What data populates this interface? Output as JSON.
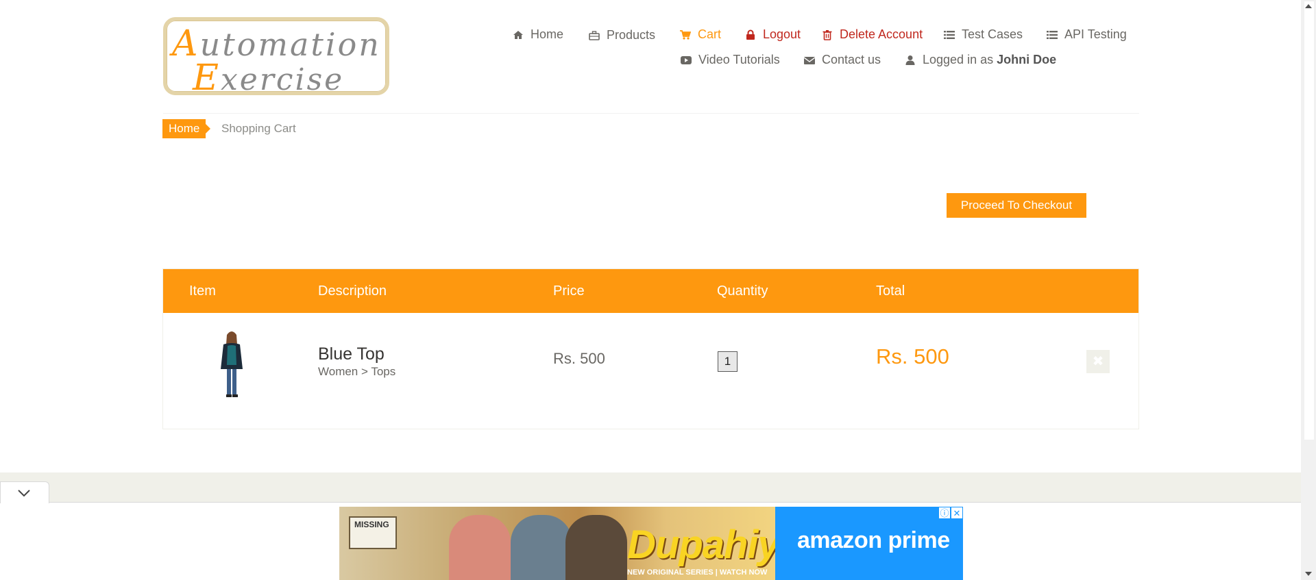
{
  "logo": {
    "line1_cap": "A",
    "line1_rest": "utomation",
    "line2_cap": "E",
    "line2_rest": "xercise"
  },
  "nav": {
    "home": "Home",
    "products": "Products",
    "cart": "Cart",
    "logout": "Logout",
    "delete_account": "Delete Account",
    "test_cases": "Test Cases",
    "api_testing": "API Testing",
    "video_tutorials": "Video Tutorials",
    "contact_us": "Contact us",
    "logged_in_prefix": "Logged in as",
    "logged_in_user": "Johni Doe"
  },
  "breadcrumb": {
    "home": "Home",
    "current": "Shopping Cart"
  },
  "checkout_button": "Proceed To Checkout",
  "table": {
    "headers": [
      "Item",
      "Description",
      "Price",
      "Quantity",
      "Total"
    ],
    "rows": [
      {
        "name": "Blue Top",
        "category": "Women > Tops",
        "price": "Rs. 500",
        "quantity": "1",
        "total": "Rs. 500"
      }
    ]
  },
  "ad": {
    "sign_text": "MISSING",
    "title": "DupahiyA",
    "subtitle": "NEW ORIGINAL SERIES | WATCH NOW",
    "brand": "amazon prime",
    "info_symbol": "ⓘ",
    "close_symbol": "✕"
  },
  "colors": {
    "accent": "#FE980F",
    "danger": "#C0271D",
    "text": "#696763",
    "ad_blue": "#1A98FF"
  },
  "icons": {
    "home": "home-icon",
    "products": "briefcase-icon",
    "cart": "cart-icon",
    "logout": "lock-icon",
    "delete": "trash-icon",
    "test_cases": "list-icon",
    "api": "list-icon",
    "video": "youtube-icon",
    "contact": "envelope-icon",
    "user": "user-icon",
    "remove": "times-icon",
    "collapse": "chevron-down-icon"
  }
}
